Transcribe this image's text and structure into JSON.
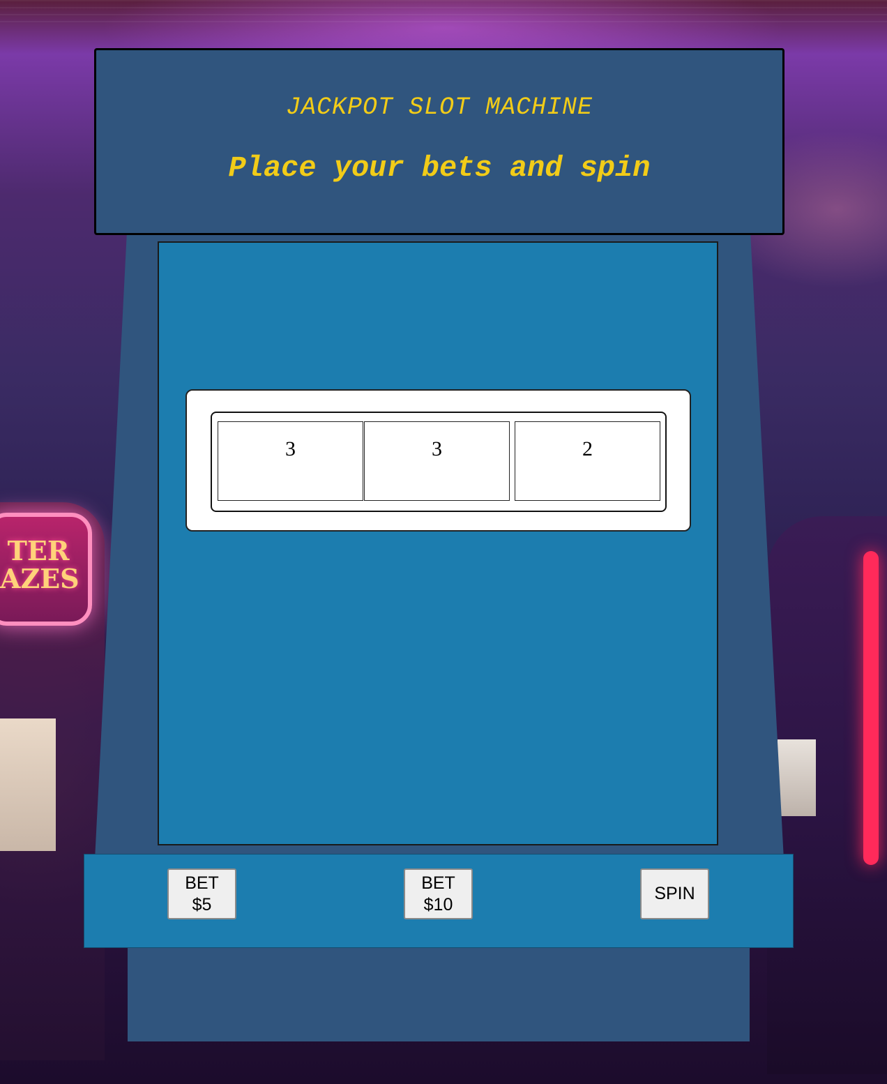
{
  "header": {
    "title": "JACKPOT SLOT MACHINE",
    "subtitle": "Place your bets and spin"
  },
  "reels": [
    {
      "value": "3"
    },
    {
      "value": "3"
    },
    {
      "value": "2"
    }
  ],
  "controls": {
    "bet5": {
      "line1": "BET",
      "line2": "$5"
    },
    "bet10": {
      "line1": "BET",
      "line2": "$10"
    },
    "spin": {
      "label": "SPIN"
    }
  },
  "colors": {
    "cabinet": "#30557e",
    "screen": "#1c7daf",
    "title_text": "#f2cc18"
  }
}
